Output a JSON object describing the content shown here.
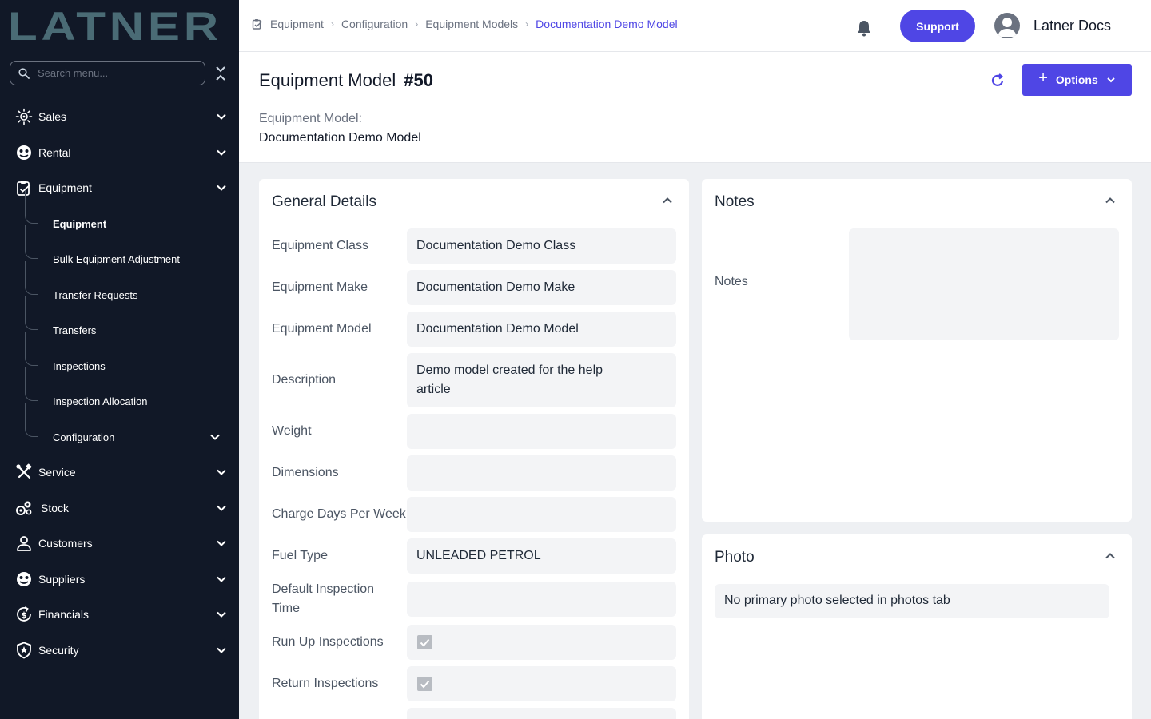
{
  "app": {
    "logo_text": "LATNER"
  },
  "sidebar": {
    "search_placeholder": "Search menu...",
    "items": [
      {
        "label": "Sales",
        "icon": "sales-icon"
      },
      {
        "label": "Rental",
        "icon": "rental-icon"
      },
      {
        "label": "Equipment",
        "icon": "equipment-icon"
      },
      {
        "label": "Service",
        "icon": "service-icon"
      },
      {
        "label": "Stock",
        "icon": "stock-icon"
      },
      {
        "label": "Customers",
        "icon": "customers-icon"
      },
      {
        "label": "Suppliers",
        "icon": "suppliers-icon"
      },
      {
        "label": "Financials",
        "icon": "financials-icon"
      },
      {
        "label": "Security",
        "icon": "security-icon"
      }
    ],
    "equipment_sub": [
      {
        "label": "Equipment",
        "active": true
      },
      {
        "label": "Bulk Equipment Adjustment"
      },
      {
        "label": "Transfer Requests"
      },
      {
        "label": "Transfers"
      },
      {
        "label": "Inspections"
      },
      {
        "label": "Inspection Allocation"
      },
      {
        "label": "Configuration"
      }
    ]
  },
  "topbar": {
    "breadcrumb": [
      "Equipment",
      "Configuration",
      "Equipment Models",
      "Documentation Demo Model"
    ],
    "support_label": "Support",
    "user_name": "Latner Docs"
  },
  "header": {
    "title": "Equipment Model",
    "number": "#50",
    "subtitle_label": "Equipment Model:",
    "subtitle_value": "Documentation Demo Model",
    "options_label": "Options"
  },
  "general": {
    "title": "General Details",
    "fields": [
      {
        "label": "Equipment Class",
        "value": "Documentation Demo Class"
      },
      {
        "label": "Equipment Make",
        "value": "Documentation Demo Make"
      },
      {
        "label": "Equipment Model",
        "value": "Documentation Demo Model"
      },
      {
        "label": "Description",
        "value": "Demo model created for the help article"
      },
      {
        "label": "Weight",
        "value": ""
      },
      {
        "label": "Dimensions",
        "value": ""
      },
      {
        "label": "Charge Days Per Week",
        "value": ""
      },
      {
        "label": "Fuel Type",
        "value": "UNLEADED PETROL"
      },
      {
        "label": "Default Inspection Time",
        "value": ""
      },
      {
        "label": "Run Up Inspections",
        "checked": true
      },
      {
        "label": "Return Inspections",
        "checked": true
      }
    ]
  },
  "notes": {
    "title": "Notes",
    "label": "Notes",
    "value": ""
  },
  "photo": {
    "title": "Photo",
    "message": "No primary photo selected in photos tab"
  },
  "colors": {
    "sidebar_bg": "#111827",
    "accent": "#4f46e5",
    "logo": "#4a6b75"
  }
}
